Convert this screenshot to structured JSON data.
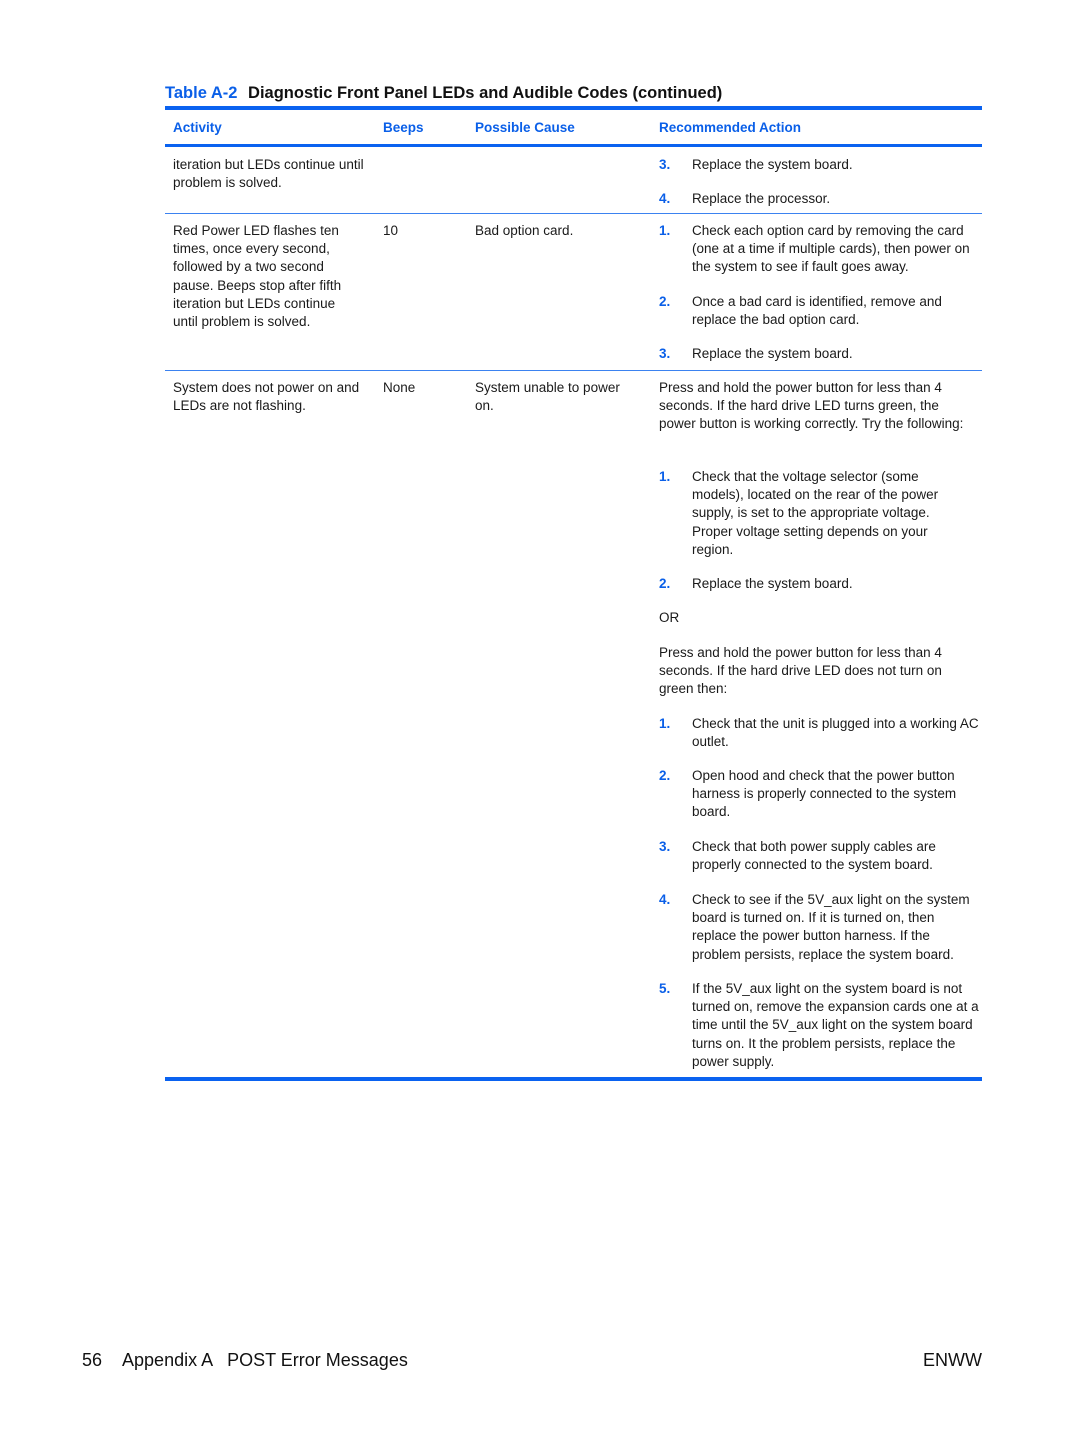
{
  "caption": {
    "label": "Table A-2",
    "title": "Diagnostic Front Panel LEDs and Audible Codes (continued)"
  },
  "table": {
    "headers": [
      "Activity",
      "Beeps",
      "Possible Cause",
      "Recommended Action"
    ],
    "rows": [
      {
        "activity": "iteration but LEDs continue until problem is solved.",
        "beeps": "",
        "cause": "",
        "steps": [
          {
            "num": "3.",
            "text": "Replace the system board."
          },
          {
            "num": "4.",
            "text": "Replace the processor."
          }
        ]
      },
      {
        "activity": "Red Power LED flashes ten times, once every second, followed by a two second pause. Beeps stop after fifth iteration but LEDs continue until problem is solved.",
        "beeps": "10",
        "cause": "Bad option card.",
        "steps": [
          {
            "num": "1.",
            "text": "Check each option card by removing the card (one at a time if multiple cards), then power on the system to see if fault goes away."
          },
          {
            "num": "2.",
            "text": "Once a bad card is identified, remove and replace the bad option card."
          },
          {
            "num": "3.",
            "text": "Replace the system board."
          }
        ]
      },
      {
        "activity": "System does not power on and LEDs are not flashing.",
        "beeps": "None",
        "cause": "System unable to power on.",
        "intro": "Press and hold the power button for less than 4 seconds. If the hard drive LED turns green, the power button is working correctly. Try the following:",
        "steps": [
          {
            "num": "1.",
            "text": "Check that the voltage selector (some models), located on the rear of the power supply, is set to the appropriate voltage. Proper voltage setting depends on your region."
          },
          {
            "num": "2.",
            "text": "Replace the system board."
          }
        ],
        "or": "OR",
        "intro2": "Press and hold the power button for less than 4 seconds. If the hard drive LED does not turn on green then:",
        "steps2": [
          {
            "num": "1.",
            "text": "Check that the unit is plugged into a working AC outlet."
          },
          {
            "num": "2.",
            "text": "Open hood and check that the power button harness is properly connected to the system board."
          },
          {
            "num": "3.",
            "text": "Check that both power supply cables are properly connected to the system board."
          },
          {
            "num": "4.",
            "text": "Check to see if the 5V_aux light on the system board is turned on. If it is turned on, then replace the power button harness. If the problem persists, replace the system board."
          },
          {
            "num": "5.",
            "text": "If the 5V_aux light on the system board is not turned on, remove the expansion cards one at a time until the 5V_aux light on the system board turns on. It the problem persists, replace the power supply."
          }
        ]
      }
    ]
  },
  "footer": {
    "page_number": "56",
    "appendix": "Appendix A",
    "section": "POST Error Messages",
    "right": "ENWW"
  },
  "colors": {
    "accent": "#0a62f0"
  }
}
